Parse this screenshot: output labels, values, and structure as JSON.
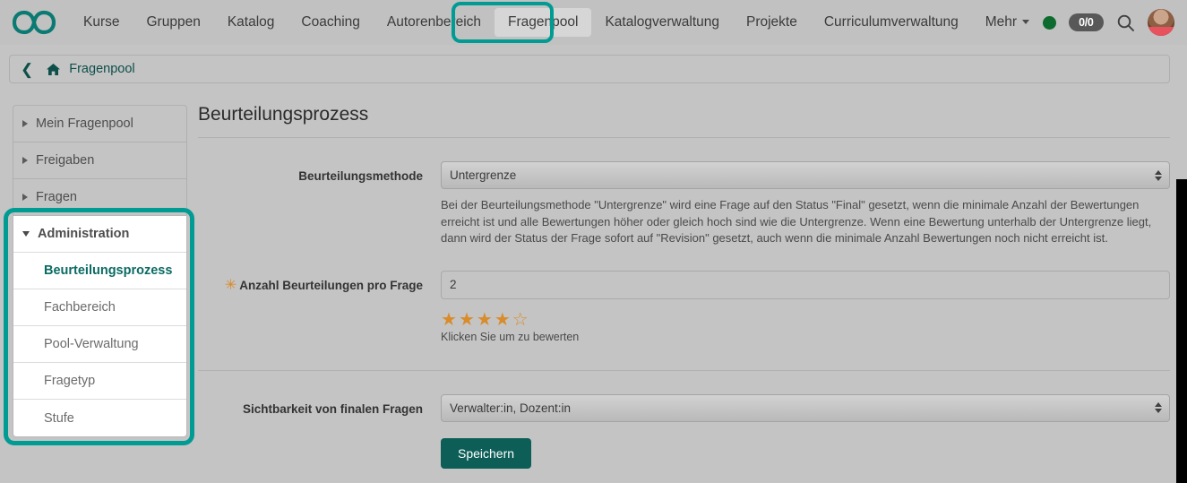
{
  "navbar": {
    "logo_icon": "infinity-logo-icon",
    "links": [
      {
        "label": "Kurse",
        "active": false
      },
      {
        "label": "Gruppen",
        "active": false
      },
      {
        "label": "Katalog",
        "active": false
      },
      {
        "label": "Coaching",
        "active": false
      },
      {
        "label": "Autorenbereich",
        "active": false
      },
      {
        "label": "Fragenpool",
        "active": true
      },
      {
        "label": "Katalogverwaltung",
        "active": false
      },
      {
        "label": "Projekte",
        "active": false
      },
      {
        "label": "Curriculumverwaltung",
        "active": false
      }
    ],
    "more_label": "Mehr",
    "status_dot": "online-status-icon",
    "count_badge": "0/0",
    "search_icon": "search-icon",
    "avatar": "user-avatar",
    "avatar_caret": "chevron-down-icon"
  },
  "breadcrumb": {
    "back_icon": "chevron-left-icon",
    "home_icon": "home-icon",
    "label": "Fragenpool"
  },
  "sidebar": {
    "items": [
      {
        "label": "Mein Fragenpool",
        "expanded": false
      },
      {
        "label": "Freigaben",
        "expanded": false
      },
      {
        "label": "Fragen",
        "expanded": false
      }
    ],
    "admin": {
      "label": "Administration",
      "expanded": true,
      "sub_items": [
        {
          "label": "Beurteilungsprozess",
          "current": true
        },
        {
          "label": "Fachbereich",
          "current": false
        },
        {
          "label": "Pool-Verwaltung",
          "current": false
        },
        {
          "label": "Fragetyp",
          "current": false
        },
        {
          "label": "Stufe",
          "current": false
        }
      ]
    }
  },
  "main": {
    "title": "Beurteilungsprozess",
    "method": {
      "label": "Beurteilungsmethode",
      "value": "Untergrenze",
      "help": "Bei der Beurteilungsmethode \"Untergrenze\" wird eine Frage auf den Status \"Final\" gesetzt, wenn die minimale Anzahl der Bewertungen erreicht ist und alle Bewertungen höher oder gleich hoch sind wie die Untergrenze. Wenn eine Bewertung unterhalb der Untergrenze liegt, dann wird der Status der Frage sofort auf \"Revision\" gesetzt, auch wenn die minimale Anzahl Bewertungen noch nicht erreicht ist."
    },
    "count": {
      "label": "Anzahl Beurteilungen pro Frage",
      "required_marker": "✳",
      "value": "2"
    },
    "rating": {
      "filled": 4,
      "total": 5,
      "filled_glyph": "★",
      "empty_glyph": "☆",
      "hint": "Klicken Sie um zu bewerten",
      "color": "#d98c2b"
    },
    "visibility": {
      "label": "Sichtbarkeit von finalen Fragen",
      "value": "Verwalter:in, Dozent:in"
    },
    "save_label": "Speichern"
  },
  "colors": {
    "accent_teal": "#009b93",
    "button_teal": "#0c5e57",
    "link_teal": "#0d4f4a",
    "star_orange": "#d98c2b",
    "page_bg": "#c4c4c4"
  }
}
